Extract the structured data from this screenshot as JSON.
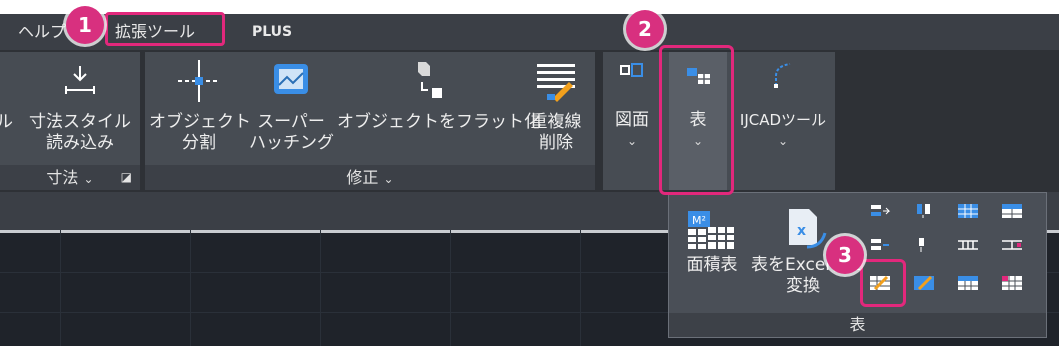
{
  "menu_tabs": {
    "help": "ヘルプ",
    "extension": "拡張ツール",
    "plus": "PLUS"
  },
  "panels": {
    "dimension": {
      "footer": "寸法",
      "items": [
        "ル",
        "寸法スタイル",
        "読み込み"
      ],
      "left_cut": "ル"
    },
    "modify": {
      "footer": "修正",
      "object_split": [
        "オブジェクト",
        "分割"
      ],
      "super_hatch": [
        "スーパー",
        "ハッチング"
      ],
      "flatten": "オブジェクトをフラット化",
      "overlap_delete": [
        "重複線",
        "削除"
      ]
    },
    "drawing_panel": {
      "label": "図面"
    },
    "table_panel": {
      "label": "表"
    },
    "ijcad_panel": {
      "label": "IJCADツール"
    }
  },
  "dropdown": {
    "footer": "表",
    "area_table": "面積表",
    "excel_convert": [
      "表をExcel表に",
      "変換"
    ]
  },
  "badges": [
    "1",
    "2",
    "3"
  ],
  "icons": [
    "dimension-style-icon",
    "split-object-icon",
    "super-hatch-icon",
    "flatten-icon",
    "overlap-delete-icon",
    "drawing-icon",
    "table-icon",
    "ijcad-tool-icon",
    "area-table-icon",
    "excel-convert-icon"
  ],
  "colors": {
    "accent": "#e2287c",
    "badge": "#d8307f",
    "icon_blue": "#3a8ee6",
    "icon_orange": "#f2a01c"
  }
}
